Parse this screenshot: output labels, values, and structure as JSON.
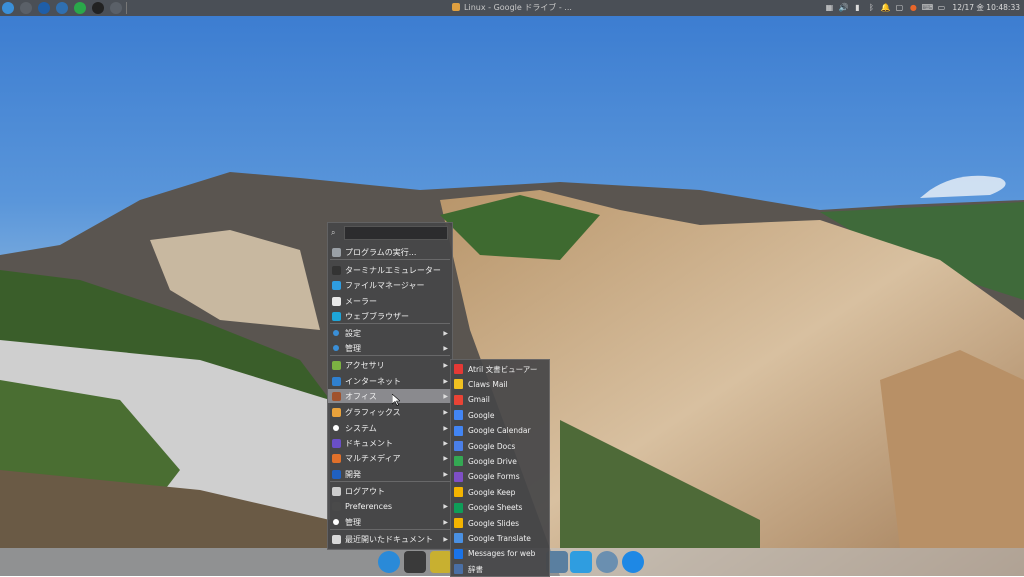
{
  "top_panel": {
    "window_title": "Linux - Google ドライブ - ...",
    "clock": "12/17 金 10:48:33",
    "launchers": [
      {
        "icon": "start-menu-icon",
        "color": "#3a8fd8"
      },
      {
        "icon": "power-icon",
        "color": "#5a6068"
      },
      {
        "icon": "browser-icon",
        "color": "#1e5ea8"
      },
      {
        "icon": "settings-icon",
        "color": "#2f6fb0"
      },
      {
        "icon": "update-icon",
        "color": "#2aa84a"
      },
      {
        "icon": "people-icon",
        "color": "#222222"
      },
      {
        "icon": "minus-icon",
        "color": "#5a6068"
      }
    ],
    "tray": [
      "network-icon",
      "volume-icon",
      "battery-icon",
      "bluetooth-icon",
      "notification-icon",
      "window-icon",
      "firefox-icon",
      "keyboard-icon",
      "display-icon"
    ]
  },
  "menu": {
    "search_value": "",
    "items": [
      {
        "label": "プログラムの実行...",
        "icon": "run-icon",
        "color": "#9aa0a6",
        "arrow": false
      },
      {
        "label": "ターミナルエミュレーター",
        "icon": "terminal-icon",
        "color": "#333333",
        "arrow": false
      },
      {
        "label": "ファイルマネージャー",
        "icon": "file-manager-icon",
        "color": "#2f9de0",
        "arrow": false
      },
      {
        "label": "メーラー",
        "icon": "mail-icon",
        "color": "#e8e8e8",
        "arrow": false
      },
      {
        "label": "ウェブブラウザー",
        "icon": "web-browser-icon",
        "color": "#1ea6d9",
        "arrow": false
      },
      {
        "label": "設定",
        "icon": "settings-dot-icon",
        "color": "#3a8fd8",
        "arrow": true
      },
      {
        "label": "管理",
        "icon": "admin-dot-icon",
        "color": "#3a8fd8",
        "arrow": true
      },
      {
        "label": "アクセサリ",
        "icon": "accessories-icon",
        "color": "#7cb342",
        "arrow": true
      },
      {
        "label": "インターネット",
        "icon": "internet-icon",
        "color": "#2f80d0",
        "arrow": true
      },
      {
        "label": "オフィス",
        "icon": "office-icon",
        "color": "#a0522d",
        "arrow": true,
        "selected": true
      },
      {
        "label": "グラフィックス",
        "icon": "graphics-icon",
        "color": "#e9a23b",
        "arrow": true
      },
      {
        "label": "システム",
        "icon": "system-dot-icon",
        "color": "#ffffff",
        "arrow": true
      },
      {
        "label": "ドキュメント",
        "icon": "help-icon",
        "color": "#6a4fc7",
        "arrow": true
      },
      {
        "label": "マルチメディア",
        "icon": "multimedia-icon",
        "color": "#e0702a",
        "arrow": true
      },
      {
        "label": "開発",
        "icon": "development-icon",
        "color": "#2060c0",
        "arrow": true
      },
      {
        "label": "ログアウト",
        "icon": "logout-icon",
        "color": "#cccccc",
        "arrow": false
      },
      {
        "label": "Preferences",
        "icon": "preferences-icon",
        "color": "#4a4a4a",
        "arrow": true
      },
      {
        "label": "管理",
        "icon": "admin2-dot-icon",
        "color": "#ffffff",
        "arrow": true
      },
      {
        "label": "最近開いたドキュメント",
        "icon": "recent-icon",
        "color": "#d8d8d8",
        "arrow": true
      }
    ]
  },
  "submenu": {
    "items": [
      {
        "label": "Atril 文書ビューアー",
        "icon": "atril-icon",
        "color": "#e53935"
      },
      {
        "label": "Claws Mail",
        "icon": "claws-mail-icon",
        "color": "#f0c020"
      },
      {
        "label": "Gmail",
        "icon": "gmail-icon",
        "color": "#ea4335"
      },
      {
        "label": "Google",
        "icon": "google-icon",
        "color": "#4285f4"
      },
      {
        "label": "Google Calendar",
        "icon": "google-calendar-icon",
        "color": "#4285f4"
      },
      {
        "label": "Google Docs",
        "icon": "google-docs-icon",
        "color": "#4a7fe8"
      },
      {
        "label": "Google Drive",
        "icon": "google-drive-icon",
        "color": "#34a853"
      },
      {
        "label": "Google Forms",
        "icon": "google-forms-icon",
        "color": "#7e4fc5"
      },
      {
        "label": "Google Keep",
        "icon": "google-keep-icon",
        "color": "#f4b400"
      },
      {
        "label": "Google Sheets",
        "icon": "google-sheets-icon",
        "color": "#0f9d58"
      },
      {
        "label": "Google Slides",
        "icon": "google-slides-icon",
        "color": "#f4b400"
      },
      {
        "label": "Google Translate",
        "icon": "google-translate-icon",
        "color": "#4a90e2"
      },
      {
        "label": "Messages for web",
        "icon": "messages-icon",
        "color": "#1a73e8"
      },
      {
        "label": "辞書",
        "icon": "dictionary-icon",
        "color": "#4a6fa5"
      }
    ]
  },
  "dock": [
    {
      "icon": "browser-dock-icon",
      "color": "#2a8ad8"
    },
    {
      "icon": "cat-dock-icon",
      "color": "#3a3a3a"
    },
    {
      "icon": "image-dock-icon",
      "color": "#c8b030"
    },
    {
      "icon": "download-dock-icon",
      "color": "#5a7fa0"
    },
    {
      "icon": "files-dock-icon",
      "color": "#2f9de0"
    },
    {
      "icon": "power-dock-icon",
      "color": "#6a8fb0"
    },
    {
      "icon": "accessibility-dock-icon",
      "color": "#1e88e5"
    }
  ]
}
